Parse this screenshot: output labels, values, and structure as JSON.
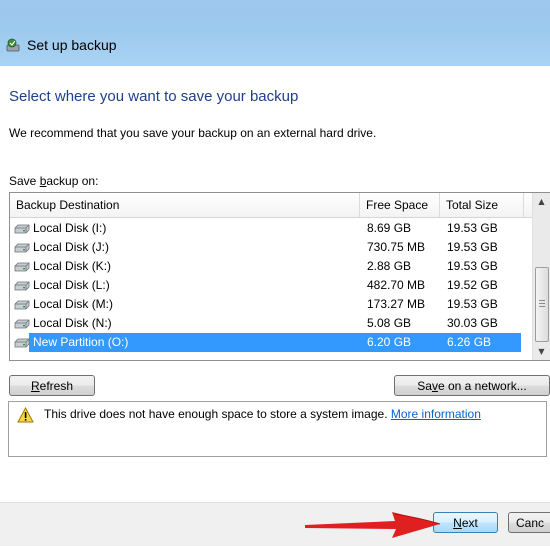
{
  "window": {
    "title": "Set up backup",
    "icon": "backup-icon"
  },
  "heading": "Select where you want to save your backup",
  "description": "We recommend that you save your backup on an external hard drive.",
  "save_label": {
    "pre": "Save ",
    "accel": "b",
    "post": "ackup on:"
  },
  "table": {
    "columns": [
      "Backup Destination",
      "Free Space",
      "Total Size"
    ],
    "rows": [
      {
        "name": "Local Disk (I:)",
        "free": "8.69 GB",
        "total": "19.53 GB",
        "selected": false
      },
      {
        "name": "Local Disk (J:)",
        "free": "730.75 MB",
        "total": "19.53 GB",
        "selected": false
      },
      {
        "name": "Local Disk (K:)",
        "free": "2.88 GB",
        "total": "19.53 GB",
        "selected": false
      },
      {
        "name": "Local Disk (L:)",
        "free": "482.70 MB",
        "total": "19.52 GB",
        "selected": false
      },
      {
        "name": "Local Disk (M:)",
        "free": "173.27 MB",
        "total": "19.53 GB",
        "selected": false
      },
      {
        "name": "Local Disk (N:)",
        "free": "5.08 GB",
        "total": "30.03 GB",
        "selected": false
      },
      {
        "name": "New Partition  (O:)",
        "free": "6.20 GB",
        "total": "6.26 GB",
        "selected": true
      }
    ]
  },
  "buttons": {
    "refresh": {
      "pre": "",
      "accel": "R",
      "post": "efresh"
    },
    "save_network": {
      "pre": "Sa",
      "accel": "v",
      "post": "e on a network..."
    },
    "next": {
      "pre": "",
      "accel": "N",
      "post": "ext"
    },
    "cancel": "Canc"
  },
  "warning": {
    "text": "This drive does not have enough space to store a system image. ",
    "link": "More information"
  },
  "colors": {
    "title_bar": "#9ec8ee",
    "heading": "#1e3f8a",
    "selection": "#3399ff",
    "link": "#0066cc",
    "annotation_arrow": "#e02020"
  }
}
